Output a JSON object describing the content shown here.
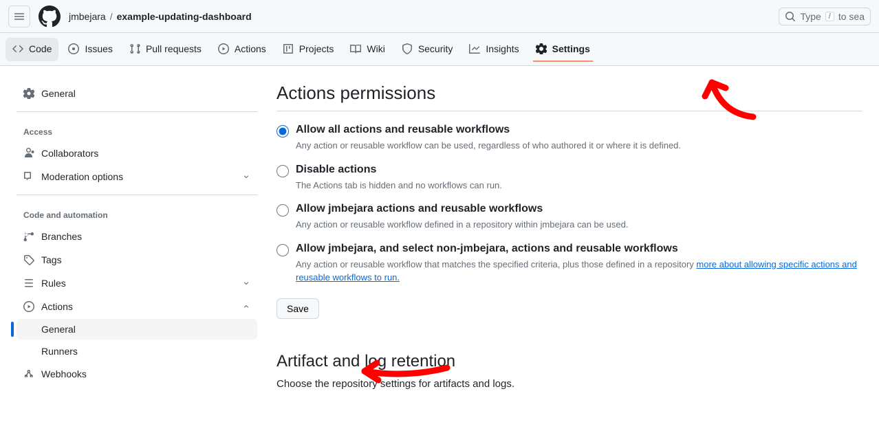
{
  "header": {
    "owner": "jmbejara",
    "sep": "/",
    "repo": "example-updating-dashboard",
    "search_placeholder": "Type",
    "search_key": "/",
    "search_suffix": "to sea"
  },
  "repoNav": {
    "code": "Code",
    "issues": "Issues",
    "pulls": "Pull requests",
    "actions": "Actions",
    "projects": "Projects",
    "wiki": "Wiki",
    "security": "Security",
    "insights": "Insights",
    "settings": "Settings"
  },
  "sidebar": {
    "general": "General",
    "access_label": "Access",
    "collaborators": "Collaborators",
    "moderation": "Moderation options",
    "code_label": "Code and automation",
    "branches": "Branches",
    "tags": "Tags",
    "rules": "Rules",
    "actions": "Actions",
    "actions_general": "General",
    "actions_runners": "Runners",
    "webhooks": "Webhooks"
  },
  "main": {
    "permissions_title": "Actions permissions",
    "opt1_label": "Allow all actions and reusable workflows",
    "opt1_desc": "Any action or reusable workflow can be used, regardless of who authored it or where it is defined.",
    "opt2_label": "Disable actions",
    "opt2_desc": "The Actions tab is hidden and no workflows can run.",
    "opt3_label": "Allow jmbejara actions and reusable workflows",
    "opt3_desc": "Any action or reusable workflow defined in a repository within jmbejara can be used.",
    "opt4_label": "Allow jmbejara, and select non-jmbejara, actions and reusable workflows",
    "opt4_desc": "Any action or reusable workflow that matches the specified criteria, plus those defined in a repository ",
    "opt4_link": "more about allowing specific actions and reusable workflows to run.",
    "save": "Save",
    "artifact_title": "Artifact and log retention",
    "artifact_desc": "Choose the repository settings for artifacts and logs."
  }
}
